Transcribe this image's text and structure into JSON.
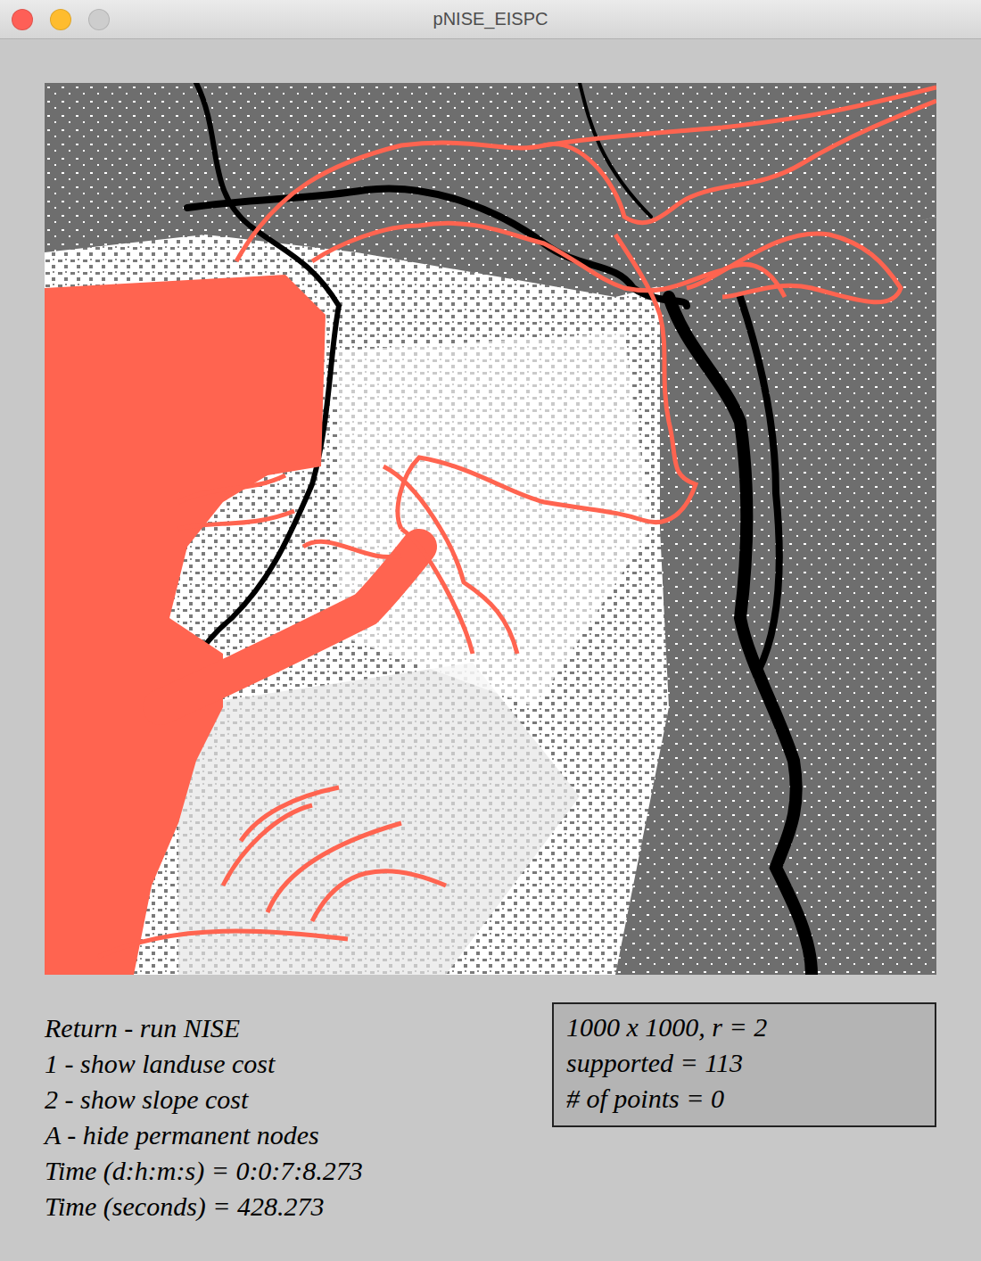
{
  "window": {
    "title": "pNISE_EISPC",
    "controls": [
      {
        "name": "close",
        "color": "#fe5f57"
      },
      {
        "name": "minimize",
        "color": "#febc2e"
      },
      {
        "name": "zoom",
        "color": "#cdcdcd"
      }
    ]
  },
  "legend": [
    "Return - run NISE",
    "1 - show landuse cost",
    "2 - show slope cost",
    "A - hide permanent nodes",
    "Time (d:h:m:s) = 0:0:7:8.273",
    "Time (seconds) = 428.273"
  ],
  "info": [
    "1000 x 1000, r = 2",
    "supported = 113",
    "# of points = 0"
  ]
}
